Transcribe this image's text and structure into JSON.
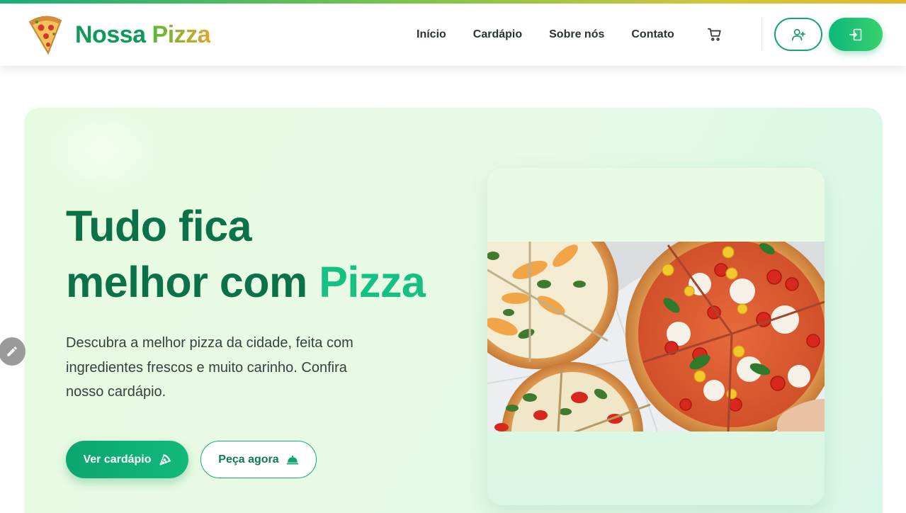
{
  "brand": {
    "name_part1": "Nossa",
    "name_part2": "Pizza",
    "logo_icon": "pizza-slice-icon"
  },
  "nav": {
    "items": [
      {
        "label": "Início"
      },
      {
        "label": "Cardápio"
      },
      {
        "label": "Sobre nós"
      },
      {
        "label": "Contato"
      }
    ],
    "cart_icon": "shopping-cart-icon",
    "register_icon": "user-plus-icon",
    "login_icon": "sign-in-icon"
  },
  "hero": {
    "title_line1": "Tudo fica",
    "title_line2_part1": "melhor com",
    "title_line2_accent": "Pizza",
    "description": "Descubra a melhor pizza da cidade, feita com ingredientes frescos e muito carinho. Confira nosso cardápio.",
    "primary_button": "Ver cardápio",
    "primary_button_icon": "pizza-icon",
    "secondary_button": "Peça agora",
    "secondary_button_icon": "cloche-icon",
    "image_icon": "pizza-photo"
  },
  "floating": {
    "edit_icon": "pencil-icon"
  },
  "colors": {
    "brand_green": "#0f9a5a",
    "accent_green": "#14c182",
    "title_green": "#0b7148",
    "hero_bg": "#e7fbe0"
  }
}
